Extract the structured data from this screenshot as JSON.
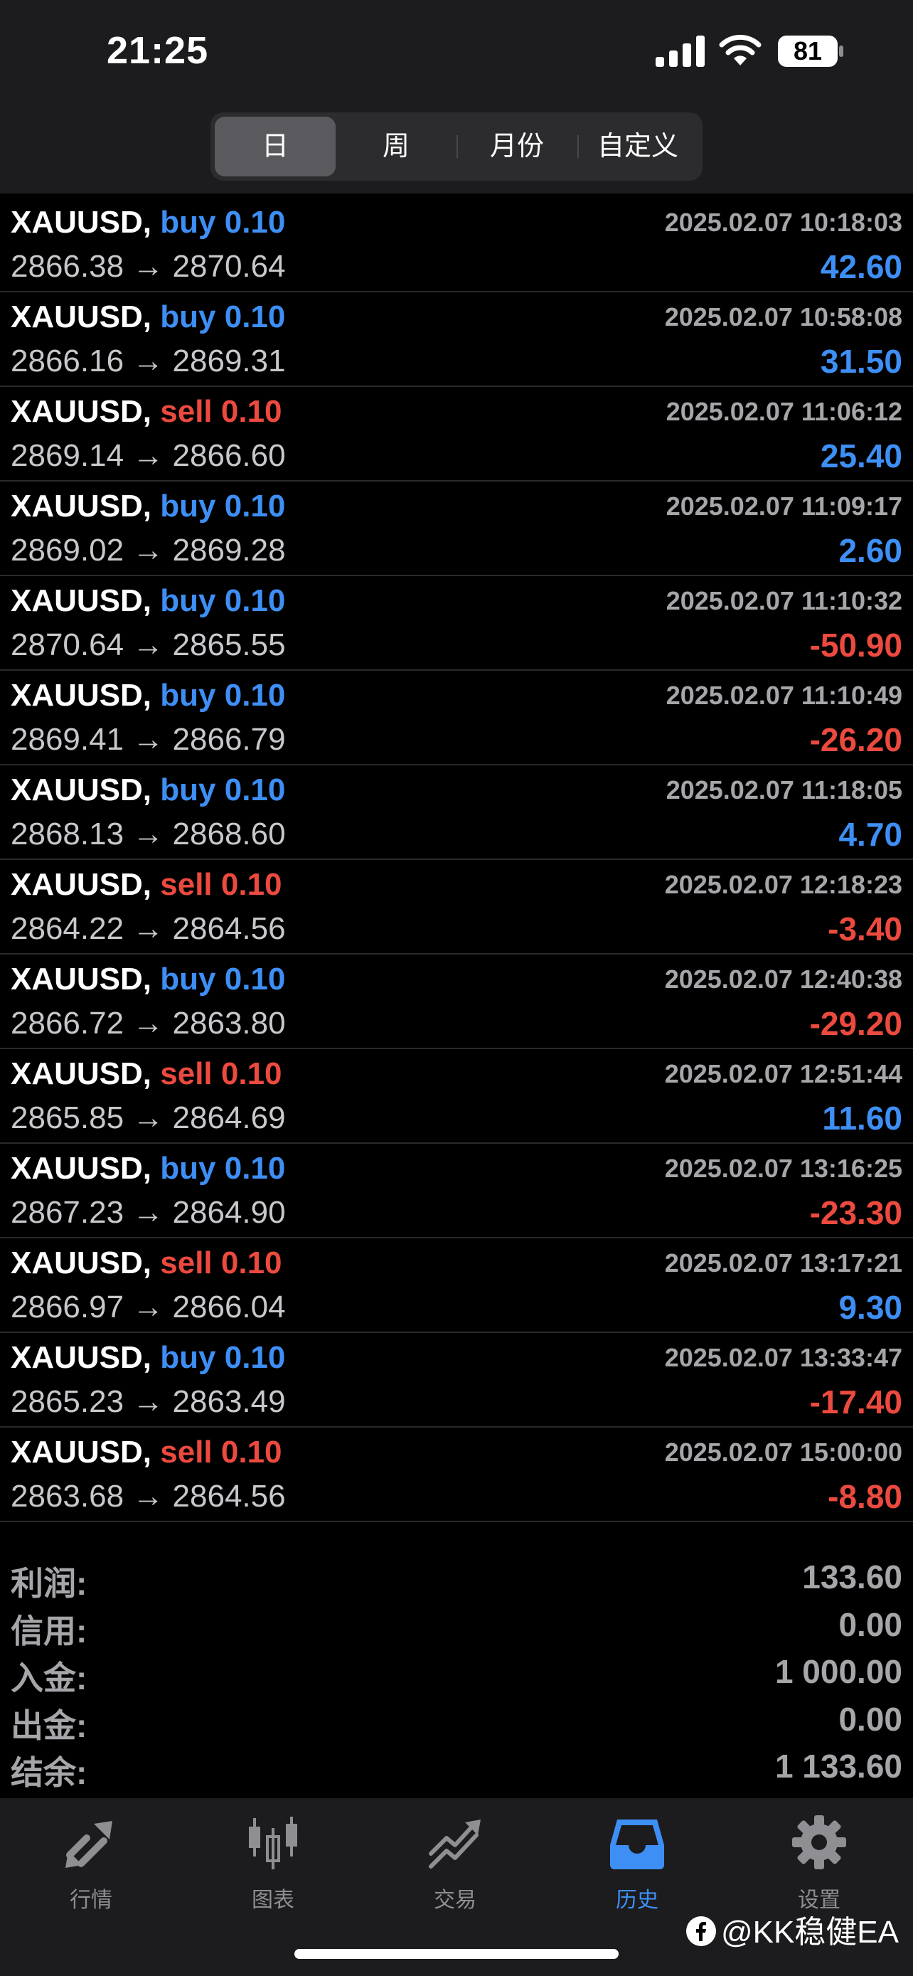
{
  "status_bar": {
    "time": "21:25",
    "battery": "81"
  },
  "period_tabs": [
    {
      "label": "日",
      "active": true
    },
    {
      "label": "周",
      "active": false
    },
    {
      "label": "月份",
      "active": false
    },
    {
      "label": "自定义",
      "active": false
    }
  ],
  "trades": [
    {
      "symbol": "XAUUSD,",
      "side": "buy",
      "volume": "0.10",
      "open": "2866.38",
      "close": "2870.64",
      "time": "2025.02.07 10:18:03",
      "profit": "42.60"
    },
    {
      "symbol": "XAUUSD,",
      "side": "buy",
      "volume": "0.10",
      "open": "2866.16",
      "close": "2869.31",
      "time": "2025.02.07 10:58:08",
      "profit": "31.50"
    },
    {
      "symbol": "XAUUSD,",
      "side": "sell",
      "volume": "0.10",
      "open": "2869.14",
      "close": "2866.60",
      "time": "2025.02.07 11:06:12",
      "profit": "25.40"
    },
    {
      "symbol": "XAUUSD,",
      "side": "buy",
      "volume": "0.10",
      "open": "2869.02",
      "close": "2869.28",
      "time": "2025.02.07 11:09:17",
      "profit": "2.60"
    },
    {
      "symbol": "XAUUSD,",
      "side": "buy",
      "volume": "0.10",
      "open": "2870.64",
      "close": "2865.55",
      "time": "2025.02.07 11:10:32",
      "profit": "-50.90"
    },
    {
      "symbol": "XAUUSD,",
      "side": "buy",
      "volume": "0.10",
      "open": "2869.41",
      "close": "2866.79",
      "time": "2025.02.07 11:10:49",
      "profit": "-26.20"
    },
    {
      "symbol": "XAUUSD,",
      "side": "buy",
      "volume": "0.10",
      "open": "2868.13",
      "close": "2868.60",
      "time": "2025.02.07 11:18:05",
      "profit": "4.70"
    },
    {
      "symbol": "XAUUSD,",
      "side": "sell",
      "volume": "0.10",
      "open": "2864.22",
      "close": "2864.56",
      "time": "2025.02.07 12:18:23",
      "profit": "-3.40"
    },
    {
      "symbol": "XAUUSD,",
      "side": "buy",
      "volume": "0.10",
      "open": "2866.72",
      "close": "2863.80",
      "time": "2025.02.07 12:40:38",
      "profit": "-29.20"
    },
    {
      "symbol": "XAUUSD,",
      "side": "sell",
      "volume": "0.10",
      "open": "2865.85",
      "close": "2864.69",
      "time": "2025.02.07 12:51:44",
      "profit": "11.60"
    },
    {
      "symbol": "XAUUSD,",
      "side": "buy",
      "volume": "0.10",
      "open": "2867.23",
      "close": "2864.90",
      "time": "2025.02.07 13:16:25",
      "profit": "-23.30"
    },
    {
      "symbol": "XAUUSD,",
      "side": "sell",
      "volume": "0.10",
      "open": "2866.97",
      "close": "2866.04",
      "time": "2025.02.07 13:17:21",
      "profit": "9.30"
    },
    {
      "symbol": "XAUUSD,",
      "side": "buy",
      "volume": "0.10",
      "open": "2865.23",
      "close": "2863.49",
      "time": "2025.02.07 13:33:47",
      "profit": "-17.40"
    },
    {
      "symbol": "XAUUSD,",
      "side": "sell",
      "volume": "0.10",
      "open": "2863.68",
      "close": "2864.56",
      "time": "2025.02.07 15:00:00",
      "profit": "-8.80"
    }
  ],
  "arrow": "→",
  "summary": [
    {
      "label": "利润:",
      "value": "133.60"
    },
    {
      "label": "信用:",
      "value": "0.00"
    },
    {
      "label": "入金:",
      "value": "1 000.00"
    },
    {
      "label": "出金:",
      "value": "0.00"
    },
    {
      "label": "结余:",
      "value": "1 133.60"
    }
  ],
  "tabbar": [
    {
      "label": "行情",
      "icon": "quotes-arrows-icon",
      "active": false
    },
    {
      "label": "图表",
      "icon": "candlestick-chart-icon",
      "active": false
    },
    {
      "label": "交易",
      "icon": "trade-trend-icon",
      "active": false
    },
    {
      "label": "历史",
      "icon": "history-inbox-icon",
      "active": true
    },
    {
      "label": "设置",
      "icon": "gear-icon",
      "active": false
    }
  ],
  "watermark": "@KK稳健EA",
  "colors": {
    "buy": "#3e8ff5",
    "sell": "#ec4a3f",
    "profit_positive": "#3e8ff5",
    "profit_negative": "#ec4a3f",
    "header_bg": "#1c1c1e",
    "active_tab": "#3e8ff5"
  }
}
